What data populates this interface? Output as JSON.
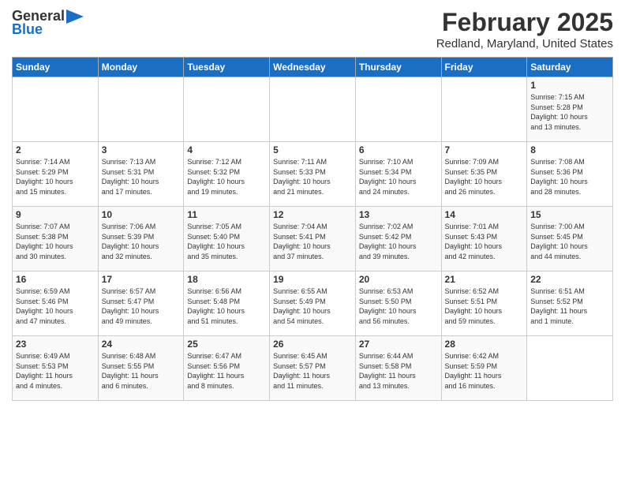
{
  "header": {
    "logo_general": "General",
    "logo_blue": "Blue",
    "month_title": "February 2025",
    "location": "Redland, Maryland, United States"
  },
  "weekdays": [
    "Sunday",
    "Monday",
    "Tuesday",
    "Wednesday",
    "Thursday",
    "Friday",
    "Saturday"
  ],
  "weeks": [
    [
      {
        "day": "",
        "detail": ""
      },
      {
        "day": "",
        "detail": ""
      },
      {
        "day": "",
        "detail": ""
      },
      {
        "day": "",
        "detail": ""
      },
      {
        "day": "",
        "detail": ""
      },
      {
        "day": "",
        "detail": ""
      },
      {
        "day": "1",
        "detail": "Sunrise: 7:15 AM\nSunset: 5:28 PM\nDaylight: 10 hours\nand 13 minutes."
      }
    ],
    [
      {
        "day": "2",
        "detail": "Sunrise: 7:14 AM\nSunset: 5:29 PM\nDaylight: 10 hours\nand 15 minutes."
      },
      {
        "day": "3",
        "detail": "Sunrise: 7:13 AM\nSunset: 5:31 PM\nDaylight: 10 hours\nand 17 minutes."
      },
      {
        "day": "4",
        "detail": "Sunrise: 7:12 AM\nSunset: 5:32 PM\nDaylight: 10 hours\nand 19 minutes."
      },
      {
        "day": "5",
        "detail": "Sunrise: 7:11 AM\nSunset: 5:33 PM\nDaylight: 10 hours\nand 21 minutes."
      },
      {
        "day": "6",
        "detail": "Sunrise: 7:10 AM\nSunset: 5:34 PM\nDaylight: 10 hours\nand 24 minutes."
      },
      {
        "day": "7",
        "detail": "Sunrise: 7:09 AM\nSunset: 5:35 PM\nDaylight: 10 hours\nand 26 minutes."
      },
      {
        "day": "8",
        "detail": "Sunrise: 7:08 AM\nSunset: 5:36 PM\nDaylight: 10 hours\nand 28 minutes."
      }
    ],
    [
      {
        "day": "9",
        "detail": "Sunrise: 7:07 AM\nSunset: 5:38 PM\nDaylight: 10 hours\nand 30 minutes."
      },
      {
        "day": "10",
        "detail": "Sunrise: 7:06 AM\nSunset: 5:39 PM\nDaylight: 10 hours\nand 32 minutes."
      },
      {
        "day": "11",
        "detail": "Sunrise: 7:05 AM\nSunset: 5:40 PM\nDaylight: 10 hours\nand 35 minutes."
      },
      {
        "day": "12",
        "detail": "Sunrise: 7:04 AM\nSunset: 5:41 PM\nDaylight: 10 hours\nand 37 minutes."
      },
      {
        "day": "13",
        "detail": "Sunrise: 7:02 AM\nSunset: 5:42 PM\nDaylight: 10 hours\nand 39 minutes."
      },
      {
        "day": "14",
        "detail": "Sunrise: 7:01 AM\nSunset: 5:43 PM\nDaylight: 10 hours\nand 42 minutes."
      },
      {
        "day": "15",
        "detail": "Sunrise: 7:00 AM\nSunset: 5:45 PM\nDaylight: 10 hours\nand 44 minutes."
      }
    ],
    [
      {
        "day": "16",
        "detail": "Sunrise: 6:59 AM\nSunset: 5:46 PM\nDaylight: 10 hours\nand 47 minutes."
      },
      {
        "day": "17",
        "detail": "Sunrise: 6:57 AM\nSunset: 5:47 PM\nDaylight: 10 hours\nand 49 minutes."
      },
      {
        "day": "18",
        "detail": "Sunrise: 6:56 AM\nSunset: 5:48 PM\nDaylight: 10 hours\nand 51 minutes."
      },
      {
        "day": "19",
        "detail": "Sunrise: 6:55 AM\nSunset: 5:49 PM\nDaylight: 10 hours\nand 54 minutes."
      },
      {
        "day": "20",
        "detail": "Sunrise: 6:53 AM\nSunset: 5:50 PM\nDaylight: 10 hours\nand 56 minutes."
      },
      {
        "day": "21",
        "detail": "Sunrise: 6:52 AM\nSunset: 5:51 PM\nDaylight: 10 hours\nand 59 minutes."
      },
      {
        "day": "22",
        "detail": "Sunrise: 6:51 AM\nSunset: 5:52 PM\nDaylight: 11 hours\nand 1 minute."
      }
    ],
    [
      {
        "day": "23",
        "detail": "Sunrise: 6:49 AM\nSunset: 5:53 PM\nDaylight: 11 hours\nand 4 minutes."
      },
      {
        "day": "24",
        "detail": "Sunrise: 6:48 AM\nSunset: 5:55 PM\nDaylight: 11 hours\nand 6 minutes."
      },
      {
        "day": "25",
        "detail": "Sunrise: 6:47 AM\nSunset: 5:56 PM\nDaylight: 11 hours\nand 8 minutes."
      },
      {
        "day": "26",
        "detail": "Sunrise: 6:45 AM\nSunset: 5:57 PM\nDaylight: 11 hours\nand 11 minutes."
      },
      {
        "day": "27",
        "detail": "Sunrise: 6:44 AM\nSunset: 5:58 PM\nDaylight: 11 hours\nand 13 minutes."
      },
      {
        "day": "28",
        "detail": "Sunrise: 6:42 AM\nSunset: 5:59 PM\nDaylight: 11 hours\nand 16 minutes."
      },
      {
        "day": "",
        "detail": ""
      }
    ]
  ]
}
